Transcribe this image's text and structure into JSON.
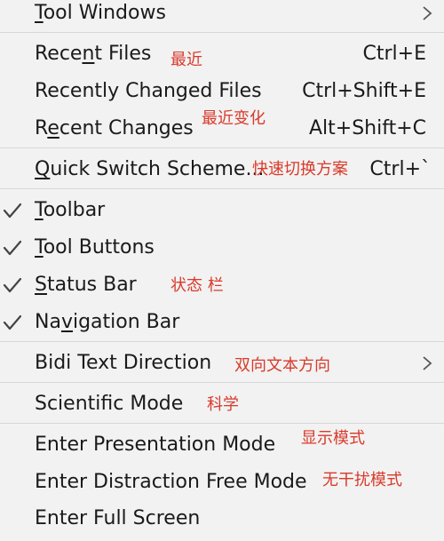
{
  "menu": {
    "tool_windows": {
      "pre": "",
      "u": "T",
      "post": "ool Windows"
    },
    "recent_files": {
      "pre": "Rece",
      "u": "n",
      "post": "t Files",
      "shortcut": "Ctrl+E",
      "note": "最近"
    },
    "recently_changed_files": {
      "pre": "Recently Changed Files",
      "u": "",
      "post": "",
      "shortcut": "Ctrl+Shift+E"
    },
    "recent_changes": {
      "pre": "R",
      "u": "e",
      "post": "cent Changes",
      "shortcut": "Alt+Shift+C",
      "note": "最近变化"
    },
    "quick_switch_scheme": {
      "pre": "",
      "u": "Q",
      "post": "uick Switch Scheme...",
      "shortcut": "Ctrl+`",
      "note": "快速切换方案"
    },
    "toolbar": {
      "pre": "",
      "u": "T",
      "post": "oolbar",
      "checked": true
    },
    "tool_buttons": {
      "pre": "",
      "u": "T",
      "post": "ool Buttons",
      "checked": true
    },
    "status_bar": {
      "pre": "",
      "u": "S",
      "post": "tatus Bar",
      "checked": true,
      "note": "状态 栏"
    },
    "navigation_bar": {
      "pre": "Na",
      "u": "v",
      "post": "igation Bar",
      "checked": true
    },
    "bidi_text_direction": {
      "pre": "Bidi Text Direction",
      "u": "",
      "post": "",
      "note": "双向文本方向"
    },
    "scientific_mode": {
      "pre": "Scientific Mode",
      "u": "",
      "post": "",
      "note": "科学"
    },
    "enter_presentation_mode": {
      "pre": "Enter Presentation Mode",
      "u": "",
      "post": "",
      "note": "显示模式"
    },
    "enter_distraction_free_mode": {
      "pre": "Enter Distraction Free Mode",
      "u": "",
      "post": "",
      "note": "无干扰模式"
    },
    "enter_full_screen": {
      "pre": "Enter Full Screen",
      "u": "",
      "post": ""
    }
  },
  "colors": {
    "background": "#f2f2f2",
    "text": "#1a1a1a",
    "annotation": "#d93a2b",
    "separator": "#d7d7d7"
  },
  "icons": {
    "check": "check-icon",
    "submenu": "chevron-right-icon"
  }
}
